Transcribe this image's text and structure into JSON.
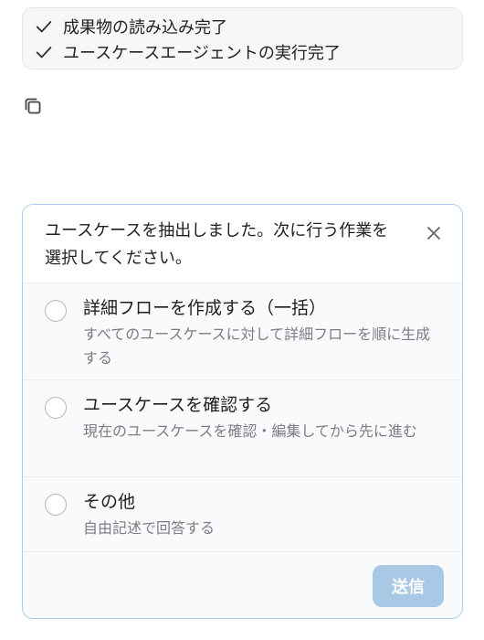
{
  "status": {
    "items": [
      {
        "icon": "check-icon",
        "label": "成果物の読み込み完了"
      },
      {
        "icon": "check-icon",
        "label": "ユースケースエージェントの実行完了"
      }
    ]
  },
  "copy": {
    "icon": "copy-icon"
  },
  "dialog": {
    "question": "ユースケースを抽出しました。次に行う作業を選択してください。",
    "close_icon": "close-icon",
    "options": [
      {
        "title": "詳細フローを作成する（一括）",
        "description": "すべてのユースケースに対して詳細フローを順に生成する"
      },
      {
        "title": "ユースケースを確認する",
        "description": "現在のユースケースを確認・編集してから先に進む"
      },
      {
        "title": "その他",
        "description": "自由記述で回答する"
      }
    ],
    "submit_label": "送信"
  },
  "colors": {
    "accent_border": "#a8cdf0",
    "submit_disabled": "#a8c8e6",
    "muted_text": "#7a7d83"
  }
}
